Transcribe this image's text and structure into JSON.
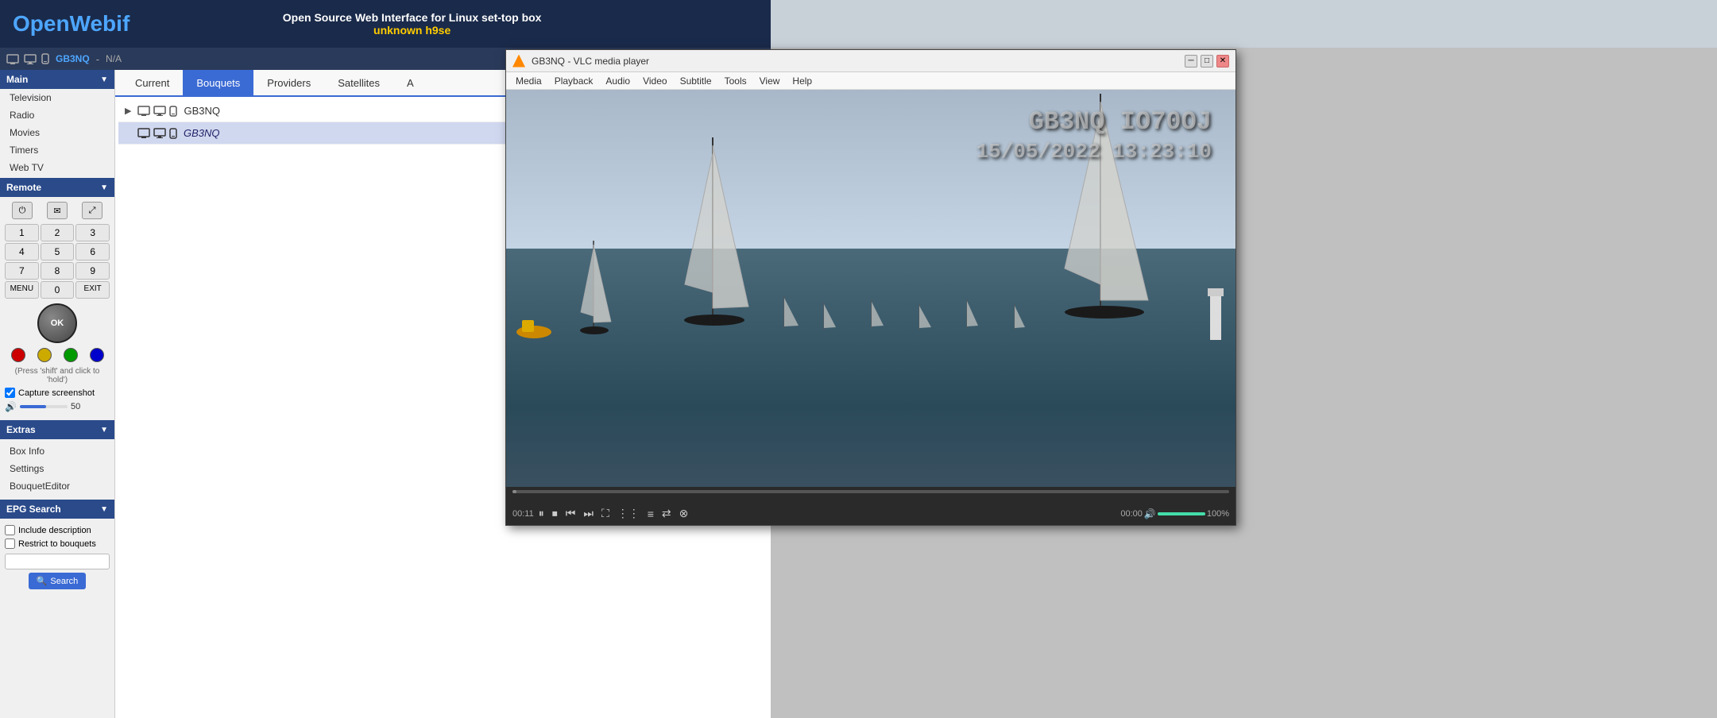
{
  "app": {
    "title": "OpenWebif",
    "title_open": "Open",
    "title_webif": "Webif",
    "tagline1": "Open Source Web Interface for Linux set-top box",
    "tagline2": "unknown h9se"
  },
  "statusbar": {
    "channel": "GB3NQ",
    "separator": "-",
    "info": "N/A"
  },
  "sidebar": {
    "main_label": "Main",
    "main_items": [
      {
        "label": "Television"
      },
      {
        "label": "Radio"
      },
      {
        "label": "Movies"
      },
      {
        "label": "Timers"
      },
      {
        "label": "Web TV"
      }
    ],
    "remote_label": "Remote",
    "press_shift": "(Press 'shift' and click to 'hold')",
    "capture_label": "Capture screenshot",
    "volume_value": "50",
    "extras_label": "Extras",
    "extras_items": [
      {
        "label": "Box Info"
      },
      {
        "label": "Settings"
      },
      {
        "label": "BouquetEditor"
      }
    ],
    "epg_label": "EPG Search",
    "include_desc": "Include description",
    "restrict_bouquets": "Restrict to bouquets",
    "search_label": "Search"
  },
  "tabs": [
    {
      "label": "Current",
      "active": false
    },
    {
      "label": "Bouquets",
      "active": true
    },
    {
      "label": "Providers",
      "active": false
    },
    {
      "label": "Satellites",
      "active": false
    },
    {
      "label": "A",
      "active": false
    }
  ],
  "bouquets": [
    {
      "name": "GB3NQ",
      "level": 0,
      "has_arrow": true,
      "icons": [
        "tv",
        "monitor",
        "mobile"
      ]
    },
    {
      "name": "GB3NQ",
      "level": 1,
      "has_arrow": false,
      "icons": [
        "tv",
        "monitor",
        "mobile"
      ],
      "italic": true
    }
  ],
  "vlc": {
    "title": "GB3NQ - VLC media player",
    "menus": [
      "Media",
      "Playback",
      "Audio",
      "Video",
      "Subtitle",
      "Tools",
      "View",
      "Help"
    ],
    "overlay_line1": "GB3NQ IO70OJ",
    "overlay_line2": "15/05/2022 13:23:10",
    "time_current": "00:11",
    "time_total": "00:00",
    "volume_pct": "100%"
  },
  "remote_buttons": {
    "numpad": [
      "1",
      "2",
      "3",
      "4",
      "5",
      "6",
      "7",
      "8",
      "9",
      "MENU",
      "0",
      "EXIT"
    ]
  }
}
